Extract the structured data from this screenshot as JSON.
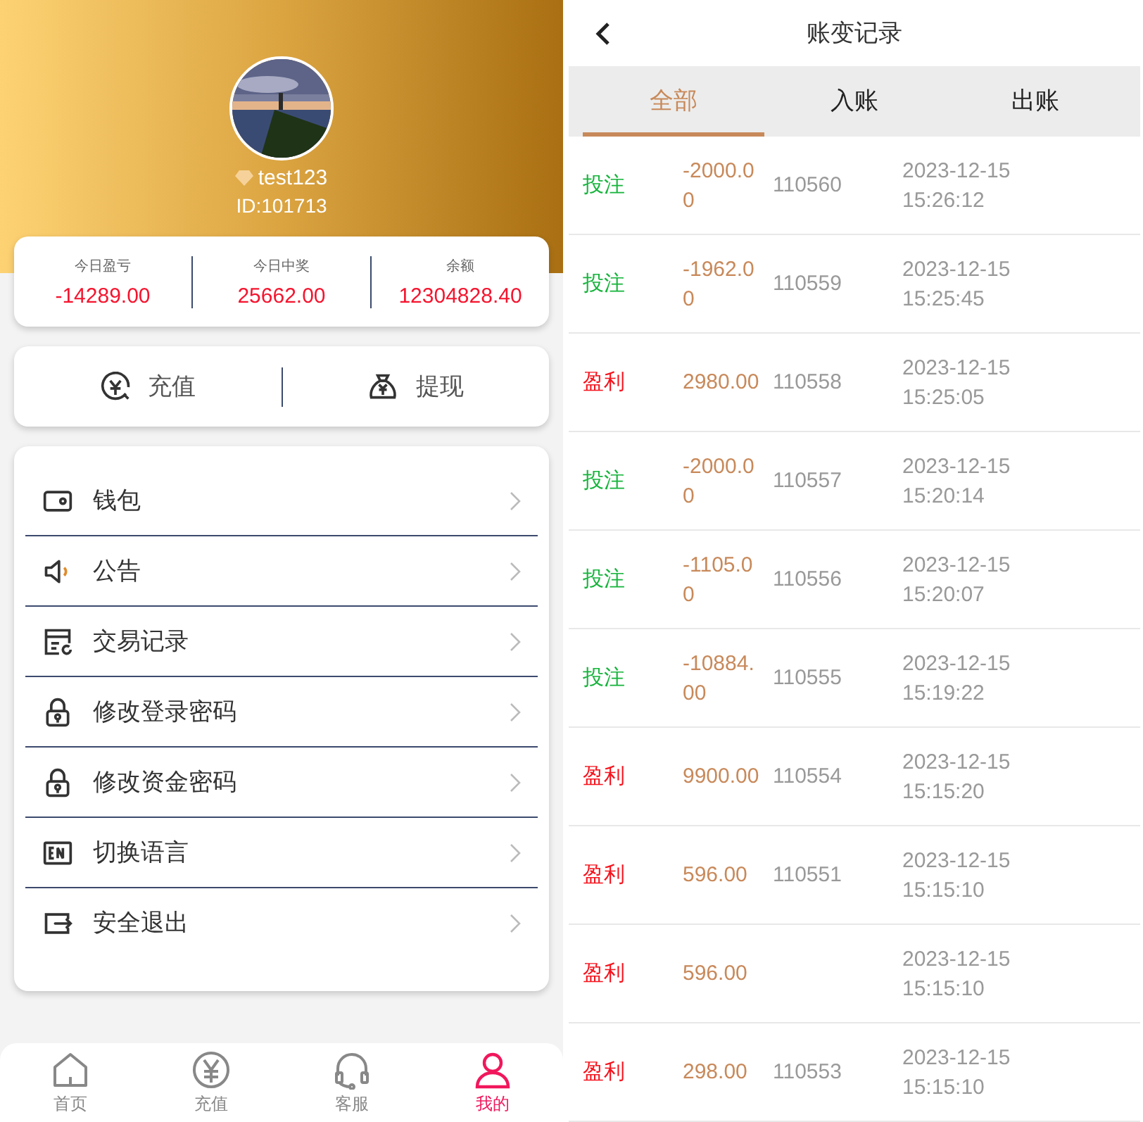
{
  "profile": {
    "username": "test123",
    "id_label": "ID:101713"
  },
  "stats": [
    {
      "label": "今日盈亏",
      "value": "-14289.00"
    },
    {
      "label": "今日中奖",
      "value": "25662.00"
    },
    {
      "label": "余额",
      "value": "12304828.40"
    }
  ],
  "actions": [
    {
      "kind": "recharge",
      "label": "充值"
    },
    {
      "kind": "withdraw",
      "label": "提现"
    }
  ],
  "menu": [
    {
      "kind": "wallet",
      "label": "钱包"
    },
    {
      "kind": "notice",
      "label": "公告"
    },
    {
      "kind": "records",
      "label": "交易记录"
    },
    {
      "kind": "lock",
      "label": "修改登录密码"
    },
    {
      "kind": "lock",
      "label": "修改资金密码"
    },
    {
      "kind": "language",
      "label": "切换语言"
    },
    {
      "kind": "logout",
      "label": "安全退出"
    }
  ],
  "bottom_nav": [
    {
      "kind": "home",
      "label": "首页",
      "selected": false
    },
    {
      "kind": "yuan",
      "label": "充值",
      "selected": false
    },
    {
      "kind": "headset",
      "label": "客服",
      "selected": false
    },
    {
      "kind": "user",
      "label": "我的",
      "selected": true
    }
  ],
  "ledger": {
    "title": "账变记录",
    "tabs": [
      {
        "label": "全部",
        "selected": true
      },
      {
        "label": "入账",
        "selected": false
      },
      {
        "label": "出账",
        "selected": false
      }
    ],
    "rows": [
      {
        "kind": "bet",
        "type": "投注",
        "amount": "-2000.00",
        "id": "110560",
        "time": "2023-12-15 15:26:12"
      },
      {
        "kind": "bet",
        "type": "投注",
        "amount": "-1962.00",
        "id": "110559",
        "time": "2023-12-15 15:25:45"
      },
      {
        "kind": "win",
        "type": "盈利",
        "amount": "2980.00",
        "id": "110558",
        "time": "2023-12-15 15:25:05"
      },
      {
        "kind": "bet",
        "type": "投注",
        "amount": "-2000.00",
        "id": "110557",
        "time": "2023-12-15 15:20:14"
      },
      {
        "kind": "bet",
        "type": "投注",
        "amount": "-1105.00",
        "id": "110556",
        "time": "2023-12-15 15:20:07"
      },
      {
        "kind": "bet",
        "type": "投注",
        "amount": "-10884.00",
        "id": "110555",
        "time": "2023-12-15 15:19:22"
      },
      {
        "kind": "win",
        "type": "盈利",
        "amount": "9900.00",
        "id": "110554",
        "time": "2023-12-15 15:15:20"
      },
      {
        "kind": "win",
        "type": "盈利",
        "amount": "596.00",
        "id": "110551",
        "time": "2023-12-15 15:15:10"
      },
      {
        "kind": "win",
        "type": "盈利",
        "amount": "596.00",
        "time": "2023-12-15 15:15:10"
      },
      {
        "kind": "win",
        "type": "盈利",
        "amount": "298.00",
        "id": "110553",
        "time": "2023-12-15 15:15:10"
      }
    ]
  }
}
